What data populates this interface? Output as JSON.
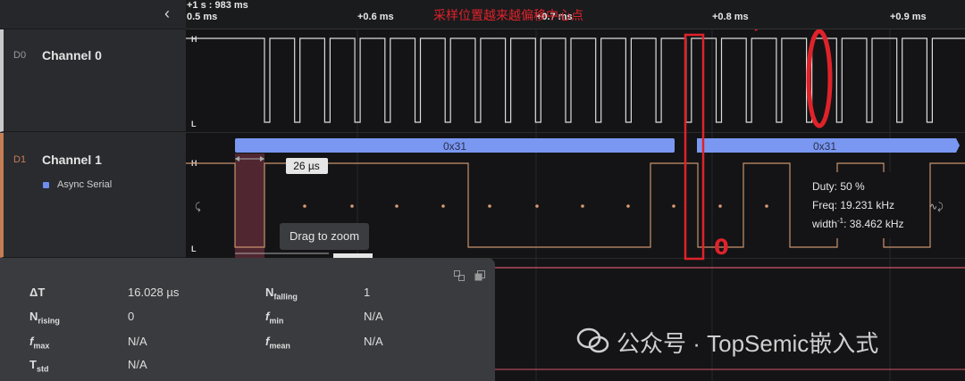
{
  "sidebar": {
    "collapse_icon": "chevron-left-icon",
    "channels": [
      {
        "id": "D0",
        "name": "Channel 0",
        "color": "#c9c9c9"
      },
      {
        "id": "D1",
        "name": "Channel 1",
        "color": "#c47e55",
        "analyzer": "Async Serial",
        "analyzer_color": "#6e8df0"
      }
    ]
  },
  "ruler": {
    "origin_top": "+1 s : 983 ms",
    "origin": "0.5 ms",
    "ticks": [
      "+0.6 ms",
      "+0.7 ms",
      "+0.8 ms",
      "+0.9 ms"
    ]
  },
  "waveform": {
    "level_high": "H",
    "level_low": "L"
  },
  "decoded": {
    "frames": [
      "0x31",
      "0x31"
    ],
    "frame_color": "#6e8df0"
  },
  "cursor_label": "26 µs",
  "tooltip": "Drag to zoom",
  "measurement": {
    "duty": "Duty: 50 %",
    "freq": "Freq: 19.231 kHz",
    "width_prefix": "width",
    "width_sup": "-1",
    "width_suffix": ": 38.462 kHz"
  },
  "panel": {
    "copy_icon": "copy-icon",
    "expand_icon": "duplicate-icon",
    "metrics": [
      {
        "label": "ΔT",
        "sub": "",
        "value": "16.028 µs"
      },
      {
        "label": "N",
        "sub": "falling",
        "value": "1"
      },
      {
        "label": "N",
        "sub": "rising",
        "value": "0"
      },
      {
        "label": "f",
        "sub": "min",
        "value": "N/A"
      },
      {
        "label": "f",
        "sub": "max",
        "value": "N/A"
      },
      {
        "label": "f",
        "sub": "mean",
        "value": "N/A"
      },
      {
        "label": "T",
        "sub": "std",
        "value": "N/A"
      }
    ]
  },
  "annotation": {
    "caption": "采样位置越来越偏移中心点",
    "mark": "0",
    "color": "#e0222a"
  },
  "watermark": {
    "text": "公众号 · TopSemic嵌入式",
    "icon": "wechat-icon"
  }
}
